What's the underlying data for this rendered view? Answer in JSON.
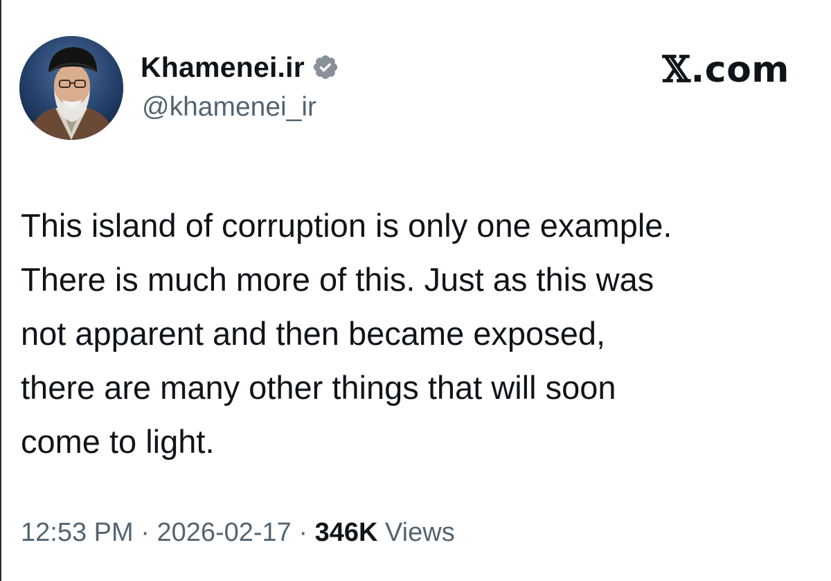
{
  "author": {
    "display_name": "Khamenei.ir",
    "handle": "@khamenei_ir",
    "verified": true,
    "verified_icon": "verified-badge-icon",
    "avatar_icon": "profile-avatar"
  },
  "brand": {
    "label": "X.com",
    "glyph": "𝕏",
    "suffix": ".com"
  },
  "tweet": {
    "text": "This island of corruption is only one example.\nThere is much more of this. Just as this was\nnot apparent and then became exposed,\nthere are many other things that will soon\ncome to light."
  },
  "meta": {
    "time": "12:53 PM",
    "separator": "·",
    "date": "2026-02-17",
    "views_count": "346K",
    "views_label": "Views"
  },
  "colors": {
    "text_primary": "#0f1419",
    "text_secondary": "#536471",
    "verified_badge": "#8a9099"
  }
}
